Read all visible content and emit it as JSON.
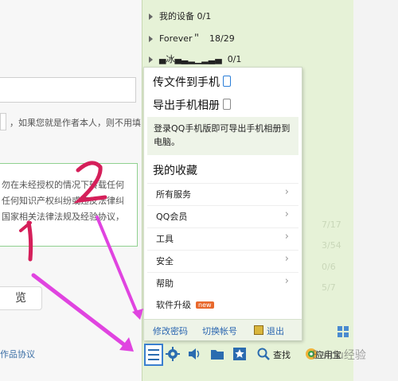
{
  "left_page": {
    "hint": "，如果您就是作者本人，则不用填",
    "warning_lines": [
      "勿在未经授权的情况下转载任何",
      "任何知识产权纠纷或违反法律纠",
      "国家相关法律法规及经验协议，"
    ],
    "preview_label": "览",
    "agreement_link": "作品协议"
  },
  "contacts": [
    {
      "name": "我的设备",
      "count": "0/1"
    },
    {
      "name": "Forever＂",
      "count": "18/29"
    },
    {
      "name": "▄冰▄▃▂▁▂▃▄",
      "count": "0/1"
    }
  ],
  "faded_counts": [
    "7/17",
    "3/54",
    "0/6",
    "5/7"
  ],
  "menu": {
    "transfer_file": "传文件到手机",
    "export_album": "导出手机相册",
    "notice": "登录QQ手机版即可导出手机相册到电脑。",
    "favorites": "我的收藏",
    "items": [
      {
        "label": "所有服务",
        "chevron": "›"
      },
      {
        "label": "QQ会员",
        "chevron": "›"
      },
      {
        "label": "工具",
        "chevron": "›"
      },
      {
        "label": "安全",
        "chevron": "›"
      },
      {
        "label": "帮助",
        "chevron": "›"
      }
    ],
    "upgrade": "软件升级",
    "new_badge": "new",
    "change_password": "修改密码",
    "switch_account": "切换帐号",
    "logout": "退出"
  },
  "toolbar": {
    "find_label": "查找",
    "app_label": "应用宝"
  },
  "annotations": {
    "one": "1",
    "two": "2"
  },
  "watermark": "Baidu经验",
  "colors": {
    "accent": "#2b7ed8",
    "panel_bg": "#e6f2d7",
    "annotation": "#d51f5a",
    "new_badge": "#e8682c"
  }
}
